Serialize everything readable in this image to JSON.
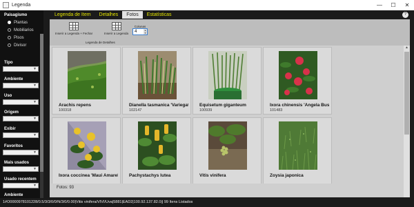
{
  "window": {
    "title": "Legenda",
    "minimize": "—",
    "maximize": "☐",
    "close": "✕"
  },
  "sidebar": {
    "paisagismo_label": "Paisagismo",
    "radio_options": [
      {
        "label": "Plantas",
        "selected": true
      },
      {
        "label": "Mobiliarios",
        "selected": false
      },
      {
        "label": "Pisos",
        "selected": false
      },
      {
        "label": "Divisor",
        "selected": false
      }
    ],
    "filters": [
      "Tipo",
      "Ambiente",
      "Uso",
      "Origem",
      "Exibir",
      "Favoritos",
      "Mais usados",
      "Usado recentem",
      "Ambiente"
    ]
  },
  "tabs": [
    {
      "label": "Legenda de Item",
      "active": false
    },
    {
      "label": "Detalhes",
      "active": false
    },
    {
      "label": "Fotos",
      "active": true
    },
    {
      "label": "Estatísticas",
      "active": false
    }
  ],
  "help": "?",
  "toolbar": {
    "insert_close_label": "Inserir a Legenda + Fechar",
    "insert_label": "Inserir a Legenda",
    "caption": "Legenda de Detalhes",
    "columns_label": "Colunas",
    "columns_value": "4"
  },
  "cards": [
    {
      "name": "Arachis repens",
      "code": "100318",
      "icon": "groundcover-photo"
    },
    {
      "name": "Dianella tasmanica 'Variegata'",
      "code": "102147",
      "icon": "dianella-photo"
    },
    {
      "name": "Equisetum giganteum",
      "code": "100939",
      "icon": "equisetum-photo"
    },
    {
      "name": "Ixora chinensis 'Angela Busm'",
      "code": "101483",
      "icon": "ixora-photo"
    },
    {
      "name": "Ixora coccinea 'Maui Amarela'",
      "code": "",
      "icon": "ixora-yellow-photo"
    },
    {
      "name": "Pachystachys lutea",
      "code": "",
      "icon": "pachystachys-photo"
    },
    {
      "name": "Vitis vinifera",
      "code": "",
      "icon": "grapevine-photo"
    },
    {
      "name": "Zoysia japonica",
      "code": "",
      "icon": "grass-photo"
    }
  ],
  "photo_count": "Fotos: 93",
  "status_text": "1#O0000978101228/0.5/3/3/0/0/N/3/0/0.00|Vitis vinifera/VIVI/Uva|5881|EAD2|100.92.137.82.0|| 99 Itens Listados"
}
